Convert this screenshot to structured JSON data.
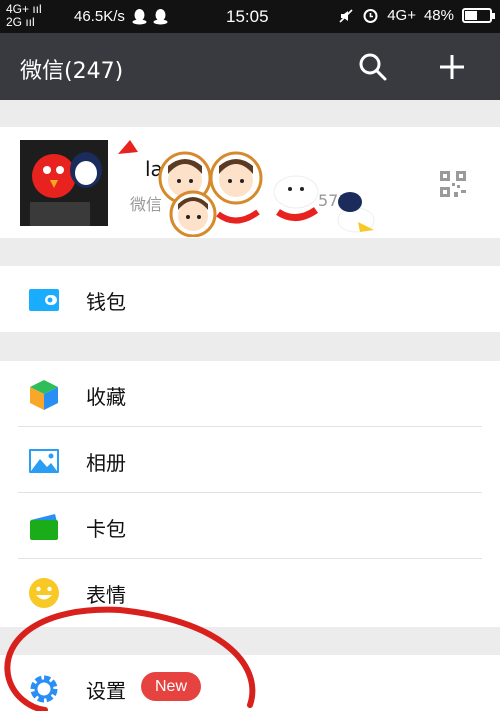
{
  "status_bar": {
    "network_top": "4G+ ııl",
    "network_bottom": "2G ııl",
    "speed": "46.5K/s",
    "time": "15:05",
    "network_right": "4G+",
    "battery": "48%",
    "battery_level": 0.48
  },
  "app_bar": {
    "title": "微信(247)",
    "search_icon": "search-icon",
    "add_icon": "plus-icon"
  },
  "profile": {
    "name_partial": "la",
    "id_partial": "微信",
    "id_suffix": "571",
    "qr_icon": "qr-code-icon"
  },
  "menu": {
    "wallet": {
      "label": "钱包",
      "icon": "wallet-icon",
      "color": "#1aadff"
    },
    "favorites": {
      "label": "收藏",
      "icon": "cube-icon"
    },
    "album": {
      "label": "相册",
      "icon": "photo-icon",
      "color": "#2a9df4"
    },
    "cards": {
      "label": "卡包",
      "icon": "card-icon",
      "color": "#1aad19"
    },
    "stickers": {
      "label": "表情",
      "icon": "smiley-icon",
      "color": "#f8c825"
    },
    "settings": {
      "label": "设置",
      "icon": "gear-icon",
      "badge": "New",
      "color": "#2a8ff4"
    }
  },
  "colors": {
    "app_bar": "#393a3f",
    "status_bar": "#121212",
    "badge": "#e64340",
    "annotation": "#d8201c"
  }
}
